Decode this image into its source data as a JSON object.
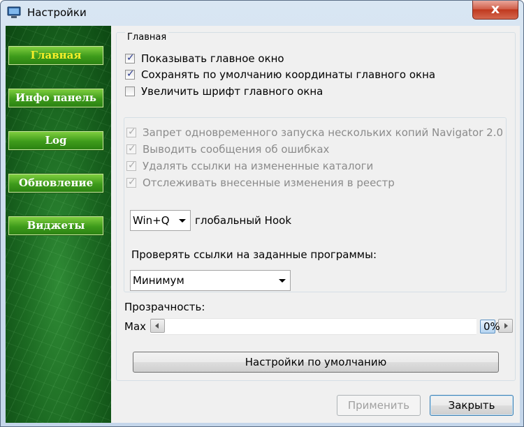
{
  "window": {
    "title": "Настройки",
    "close_label": "x"
  },
  "sidebar": {
    "items": [
      {
        "label": "Главная",
        "active": true
      },
      {
        "label": "Инфо панель",
        "active": false
      },
      {
        "label": "Log",
        "active": false
      },
      {
        "label": "Обновление",
        "active": false
      },
      {
        "label": "Виджеты",
        "active": false
      }
    ]
  },
  "main": {
    "group_title": "Главная",
    "checkboxes": [
      {
        "label": "Показывать главное окно",
        "checked": true
      },
      {
        "label": "Сохранять по умолчанию координаты главного окна",
        "checked": true
      },
      {
        "label": "Увеличить шрифт главного окна",
        "checked": false
      }
    ],
    "disabled_checkboxes": [
      {
        "label": "Запрет одновременного запуска нескольких копий Navigator 2.0",
        "checked": true
      },
      {
        "label": "Выводить сообщения об ошибках",
        "checked": true
      },
      {
        "label": "Удалять ссылки на измененные каталоги",
        "checked": true
      },
      {
        "label": "Отслеживать внесенные изменения в реестр",
        "checked": true
      }
    ],
    "hotkey": {
      "value": "Win+Q",
      "label": "глобальный Hook"
    },
    "check_links": {
      "label": "Проверять ссылки на заданные программы:",
      "value": "Минимум"
    },
    "transparency": {
      "label": "Прозрачность:",
      "min_label": "Max",
      "value_text": "0%",
      "value": 0
    },
    "defaults_button": "Настройки по умолчанию"
  },
  "footer": {
    "apply_label": "Применить",
    "close_label": "Закрыть"
  },
  "colors": {
    "sidebar_bg": "#1c6a22",
    "nav_button": "#3e9b1b",
    "active_label": "#f6ee2a"
  }
}
